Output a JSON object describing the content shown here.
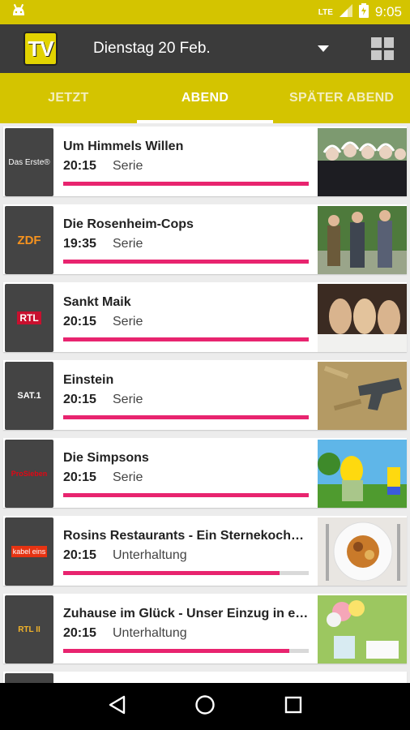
{
  "status": {
    "time": "9:05",
    "network": "LTE"
  },
  "header": {
    "logo_text": "TV",
    "date": "Dienstag 20 Feb."
  },
  "tabs": [
    {
      "label": "JETZT",
      "active": false
    },
    {
      "label": "ABEND",
      "active": true
    },
    {
      "label": "SPÄTER ABEND",
      "active": false
    }
  ],
  "accent_color": "#d4c400",
  "progress_color": "#e8246f",
  "programs": [
    {
      "channel": "Das Erste®",
      "title": "Um Himmels Willen",
      "time": "20:15",
      "genre": "Serie",
      "progress": 1.0
    },
    {
      "channel": "ZDF",
      "title": "Die Rosenheim-Cops",
      "time": "19:35",
      "genre": "Serie",
      "progress": 1.0
    },
    {
      "channel": "RTL",
      "title": "Sankt Maik",
      "time": "20:15",
      "genre": "Serie",
      "progress": 1.0
    },
    {
      "channel": "SAT.1",
      "title": "Einstein",
      "time": "20:15",
      "genre": "Serie",
      "progress": 1.0
    },
    {
      "channel": "ProSieben",
      "title": "Die Simpsons",
      "time": "20:15",
      "genre": "Serie",
      "progress": 1.0
    },
    {
      "channel": "kabel eins",
      "title": "Rosins Restaurants - Ein Sternekoch…",
      "time": "20:15",
      "genre": "Unterhaltung",
      "progress": 0.88
    },
    {
      "channel": "RTL II",
      "title": "Zuhause im Glück - Unser Einzug in e…",
      "time": "20:15",
      "genre": "Unterhaltung",
      "progress": 0.92
    }
  ]
}
